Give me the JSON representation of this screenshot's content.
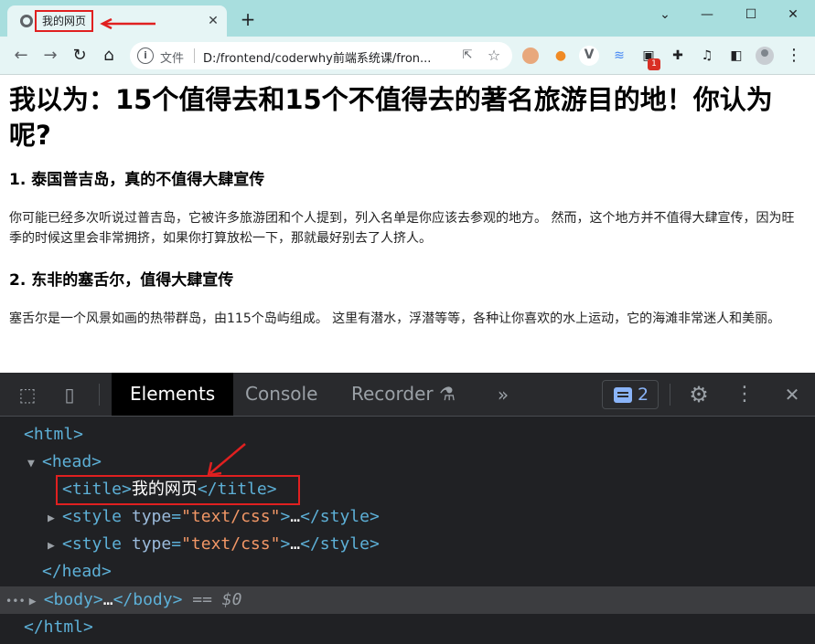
{
  "browser": {
    "tab": {
      "title": "我的网页",
      "close": "✕"
    },
    "new_tab": "+",
    "window": {
      "minimize": "—",
      "maximize": "☐",
      "close": "✕",
      "collapse": "⌄"
    },
    "toolbar": {
      "back": "←",
      "forward": "→",
      "reload": "↻",
      "home": "⌂",
      "info": "i",
      "scheme_label": "文件",
      "url": "D:/frontend/coderwhy前端系统课/fron...",
      "share": "⇱",
      "bookmark": "☆",
      "extension_badge": "1",
      "menu": "⋮"
    },
    "colors": {
      "tab_strip": "#a8dede",
      "toolbar": "#e6f5f5",
      "annotation_red": "#e02020"
    }
  },
  "page": {
    "h1": "我以为：15个值得去和15个不值得去的著名旅游目的地！你认为呢?",
    "sections": [
      {
        "heading": "1. 泰国普吉岛，真的不值得大肆宣传",
        "text": "你可能已经多次听说过普吉岛，它被许多旅游团和个人提到，列入名单是你应该去参观的地方。 然而，这个地方并不值得大肆宣传，因为旺季的时候这里会非常拥挤，如果你打算放松一下，那就最好别去了人挤人。"
      },
      {
        "heading": "2. 东非的塞舌尔，值得大肆宣传",
        "text": "塞舌尔是一个风景如画的热带群岛，由115个岛屿组成。 这里有潜水，浮潜等等，各种让你喜欢的水上运动，它的海滩非常迷人和美丽。"
      }
    ]
  },
  "devtools": {
    "tabs": [
      {
        "label": "Elements"
      },
      {
        "label": "Console"
      },
      {
        "label": "Recorder ⚗"
      }
    ],
    "more_tabs": "»",
    "issues_count": "2",
    "icons": {
      "settings": "⚙",
      "menu": "⋮",
      "close": "✕"
    },
    "tree": {
      "html_open": "<html>",
      "head_open": "<head>",
      "title_open": "<title>",
      "title_text": "我的网页",
      "title_close": "</title>",
      "style_open_prefix": "<style ",
      "style_attr_name": "type",
      "style_eq": "=",
      "style_attr_value": "\"text/css\"",
      "style_open_suffix": ">",
      "ellipsis": "…",
      "style_close": "</style>",
      "head_close": "</head>",
      "body_open": "<body>",
      "body_close": "</body>",
      "selected_marker": "== $0",
      "row_dots": "•••",
      "html_close": "</html>"
    }
  }
}
